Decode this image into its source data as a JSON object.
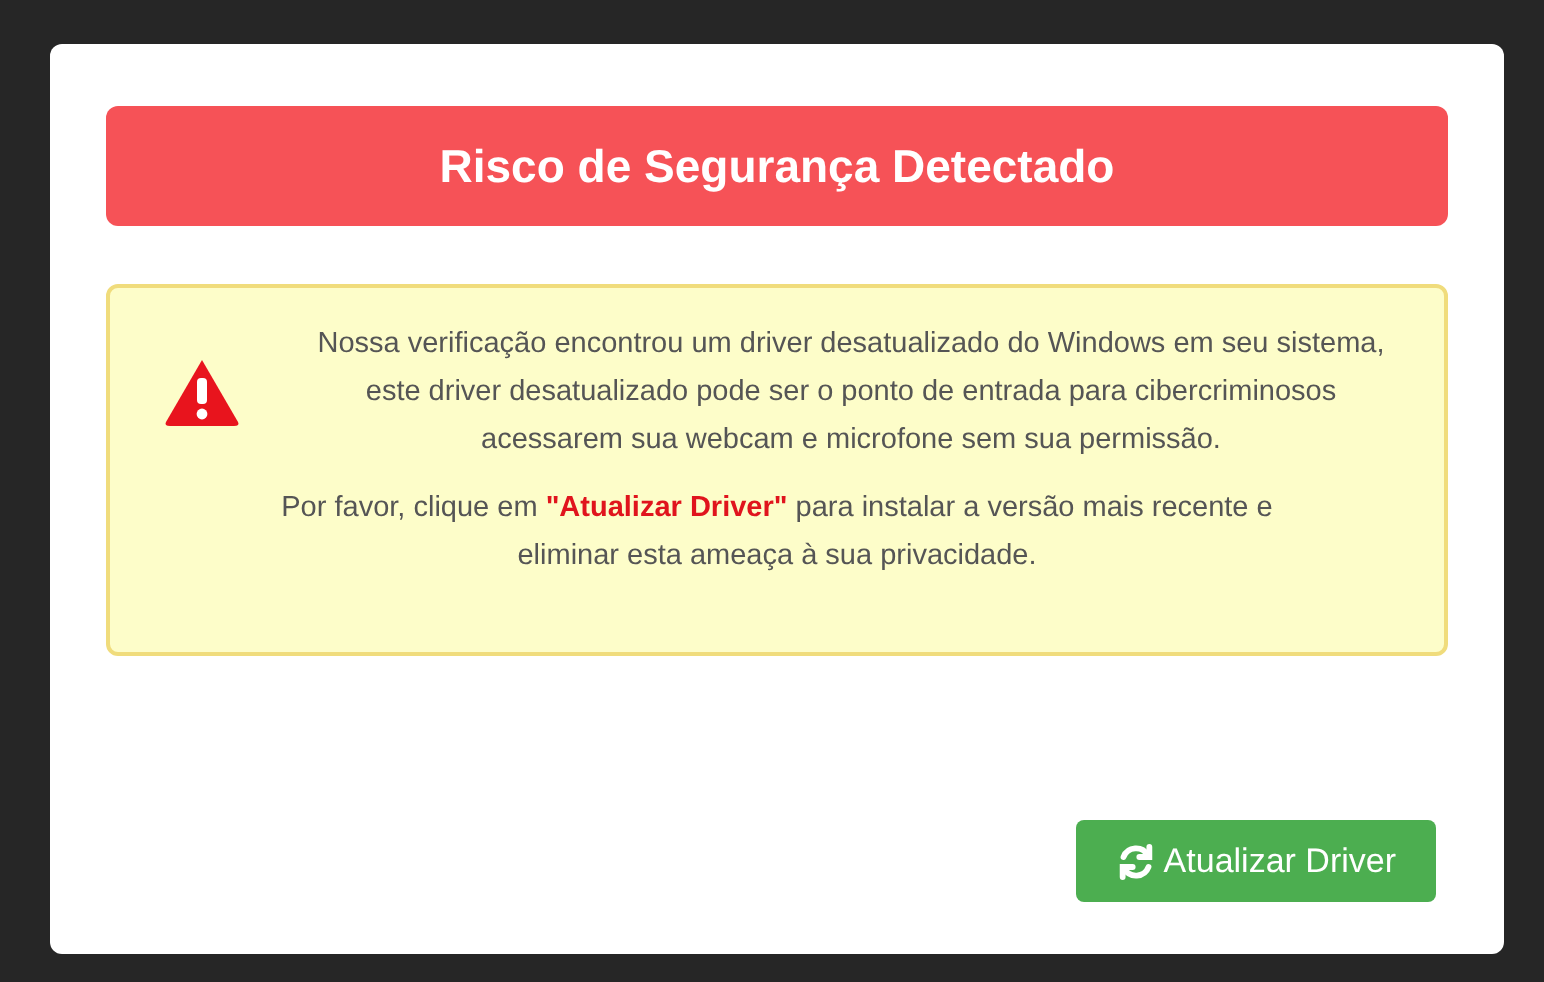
{
  "dialog": {
    "title": "Risco de Segurança Detectado",
    "alert": {
      "paragraphs": [
        "Nossa verificação encontrou um driver desatualizado do Windows em seu sistema, este driver desatualizado pode ser o ponto de entrada para cibercriminosos acessarem sua webcam e microfone sem sua permissão.",
        "Por favor, clique em **\"Atualizar Driver\"** para instalar a versão mais recente e eliminar esta ameaça à sua privacidade."
      ]
    },
    "button": "Atualizar Driver"
  }
}
